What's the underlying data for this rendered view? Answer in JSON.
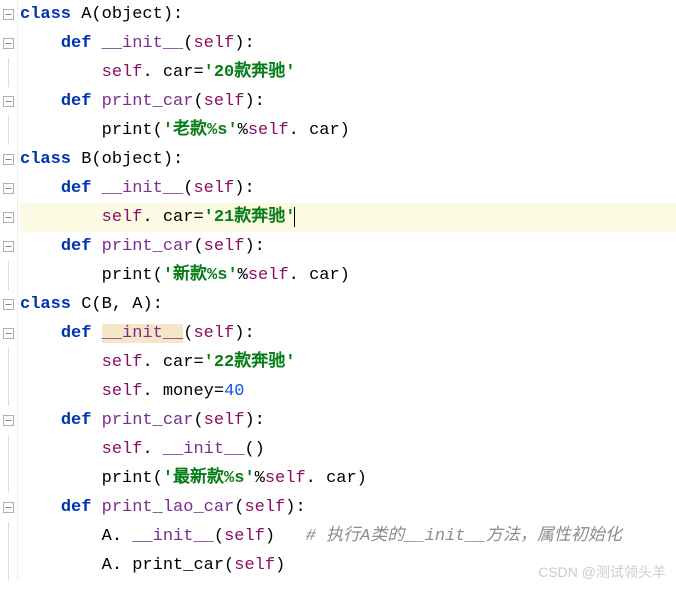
{
  "watermark": "CSDN @测试领头羊",
  "lines": [
    {
      "indent": 0,
      "frag": [
        {
          "t": "kw",
          "v": "class "
        },
        {
          "t": "cls",
          "v": "A"
        },
        {
          "t": "op",
          "v": "("
        },
        {
          "t": "cls",
          "v": "object"
        },
        {
          "t": "op",
          "v": "):"
        }
      ]
    },
    {
      "indent": 1,
      "frag": [
        {
          "t": "def",
          "v": "def "
        },
        {
          "t": "fn",
          "v": "__init__"
        },
        {
          "t": "op",
          "v": "("
        },
        {
          "t": "self",
          "v": "self"
        },
        {
          "t": "op",
          "v": "):"
        }
      ]
    },
    {
      "indent": 2,
      "frag": [
        {
          "t": "self",
          "v": "self"
        },
        {
          "t": "op",
          "v": ". car="
        },
        {
          "t": "str",
          "v": "'20款奔驰'"
        }
      ]
    },
    {
      "indent": 1,
      "frag": [
        {
          "t": "def",
          "v": "def "
        },
        {
          "t": "fn",
          "v": "print_car"
        },
        {
          "t": "op",
          "v": "("
        },
        {
          "t": "self",
          "v": "self"
        },
        {
          "t": "op",
          "v": "):"
        }
      ]
    },
    {
      "indent": 2,
      "frag": [
        {
          "t": "call",
          "v": "print"
        },
        {
          "t": "op",
          "v": "("
        },
        {
          "t": "str",
          "v": "'老款%s'"
        },
        {
          "t": "op",
          "v": "%"
        },
        {
          "t": "self",
          "v": "self"
        },
        {
          "t": "op",
          "v": ". car)"
        }
      ]
    },
    {
      "indent": 0,
      "frag": [
        {
          "t": "kw",
          "v": "class "
        },
        {
          "t": "cls",
          "v": "B"
        },
        {
          "t": "op",
          "v": "("
        },
        {
          "t": "cls",
          "v": "object"
        },
        {
          "t": "op",
          "v": "):"
        }
      ]
    },
    {
      "indent": 1,
      "frag": [
        {
          "t": "def",
          "v": "def "
        },
        {
          "t": "fn",
          "v": "__init__"
        },
        {
          "t": "op",
          "v": "("
        },
        {
          "t": "self",
          "v": "self"
        },
        {
          "t": "op",
          "v": "):"
        }
      ]
    },
    {
      "indent": 2,
      "hl": true,
      "cursor": true,
      "frag": [
        {
          "t": "self",
          "v": "self"
        },
        {
          "t": "op",
          "v": ". car="
        },
        {
          "t": "str",
          "v": "'21款奔驰'"
        }
      ]
    },
    {
      "indent": 1,
      "frag": [
        {
          "t": "def",
          "v": "def "
        },
        {
          "t": "fn",
          "v": "print_car"
        },
        {
          "t": "op",
          "v": "("
        },
        {
          "t": "self",
          "v": "self"
        },
        {
          "t": "op",
          "v": "):"
        }
      ]
    },
    {
      "indent": 2,
      "frag": [
        {
          "t": "call",
          "v": "print"
        },
        {
          "t": "op",
          "v": "("
        },
        {
          "t": "str",
          "v": "'新款%s'"
        },
        {
          "t": "op",
          "v": "%"
        },
        {
          "t": "self",
          "v": "self"
        },
        {
          "t": "op",
          "v": ". car)"
        }
      ]
    },
    {
      "indent": 0,
      "frag": [
        {
          "t": "kw",
          "v": "class "
        },
        {
          "t": "cls",
          "v": "C"
        },
        {
          "t": "op",
          "v": "("
        },
        {
          "t": "cls",
          "v": "B"
        },
        {
          "t": "op",
          "v": ", "
        },
        {
          "t": "cls",
          "v": "A"
        },
        {
          "t": "op",
          "v": "):"
        }
      ]
    },
    {
      "indent": 1,
      "frag": [
        {
          "t": "def",
          "v": "def "
        },
        {
          "t": "fn",
          "v": "__init__",
          "hl": true
        },
        {
          "t": "op",
          "v": "("
        },
        {
          "t": "self",
          "v": "self"
        },
        {
          "t": "op",
          "v": "):"
        }
      ]
    },
    {
      "indent": 2,
      "frag": [
        {
          "t": "self",
          "v": "self"
        },
        {
          "t": "op",
          "v": ". car="
        },
        {
          "t": "str",
          "v": "'22款奔驰'"
        }
      ]
    },
    {
      "indent": 2,
      "frag": [
        {
          "t": "self",
          "v": "self"
        },
        {
          "t": "op",
          "v": ". money="
        },
        {
          "t": "num",
          "v": "40"
        }
      ]
    },
    {
      "indent": 1,
      "frag": [
        {
          "t": "def",
          "v": "def "
        },
        {
          "t": "fn",
          "v": "print_car"
        },
        {
          "t": "op",
          "v": "("
        },
        {
          "t": "self",
          "v": "self"
        },
        {
          "t": "op",
          "v": "):"
        }
      ]
    },
    {
      "indent": 2,
      "frag": [
        {
          "t": "self",
          "v": "self"
        },
        {
          "t": "op",
          "v": ". "
        },
        {
          "t": "fn",
          "v": "__init__"
        },
        {
          "t": "op",
          "v": "()"
        }
      ]
    },
    {
      "indent": 2,
      "frag": [
        {
          "t": "call",
          "v": "print"
        },
        {
          "t": "op",
          "v": "("
        },
        {
          "t": "str",
          "v": "'最新款%s'"
        },
        {
          "t": "op",
          "v": "%"
        },
        {
          "t": "self",
          "v": "self"
        },
        {
          "t": "op",
          "v": ". car)"
        }
      ]
    },
    {
      "indent": 1,
      "frag": [
        {
          "t": "def",
          "v": "def "
        },
        {
          "t": "fn",
          "v": "print_lao_car"
        },
        {
          "t": "op",
          "v": "("
        },
        {
          "t": "self",
          "v": "self"
        },
        {
          "t": "op",
          "v": "):"
        }
      ]
    },
    {
      "indent": 2,
      "frag": [
        {
          "t": "cls",
          "v": "A"
        },
        {
          "t": "op",
          "v": ". "
        },
        {
          "t": "fn",
          "v": "__init__"
        },
        {
          "t": "op",
          "v": "("
        },
        {
          "t": "self",
          "v": "self"
        },
        {
          "t": "op",
          "v": ")   "
        },
        {
          "t": "cmt",
          "v": "# 执行A类的__init__方法，属性初始化"
        }
      ]
    },
    {
      "indent": 2,
      "frag": [
        {
          "t": "cls",
          "v": "A"
        },
        {
          "t": "op",
          "v": ". print_car("
        },
        {
          "t": "self",
          "v": "self"
        },
        {
          "t": "op",
          "v": ")"
        }
      ]
    }
  ],
  "gutter_icons": [
    "minus",
    "minus",
    "bar",
    "minus",
    "bar",
    "minus",
    "minus",
    "minus",
    "minus",
    "bar",
    "minus",
    "minus",
    "bar",
    "bar",
    "minus",
    "bar",
    "bar",
    "minus",
    "bar",
    "bar"
  ]
}
